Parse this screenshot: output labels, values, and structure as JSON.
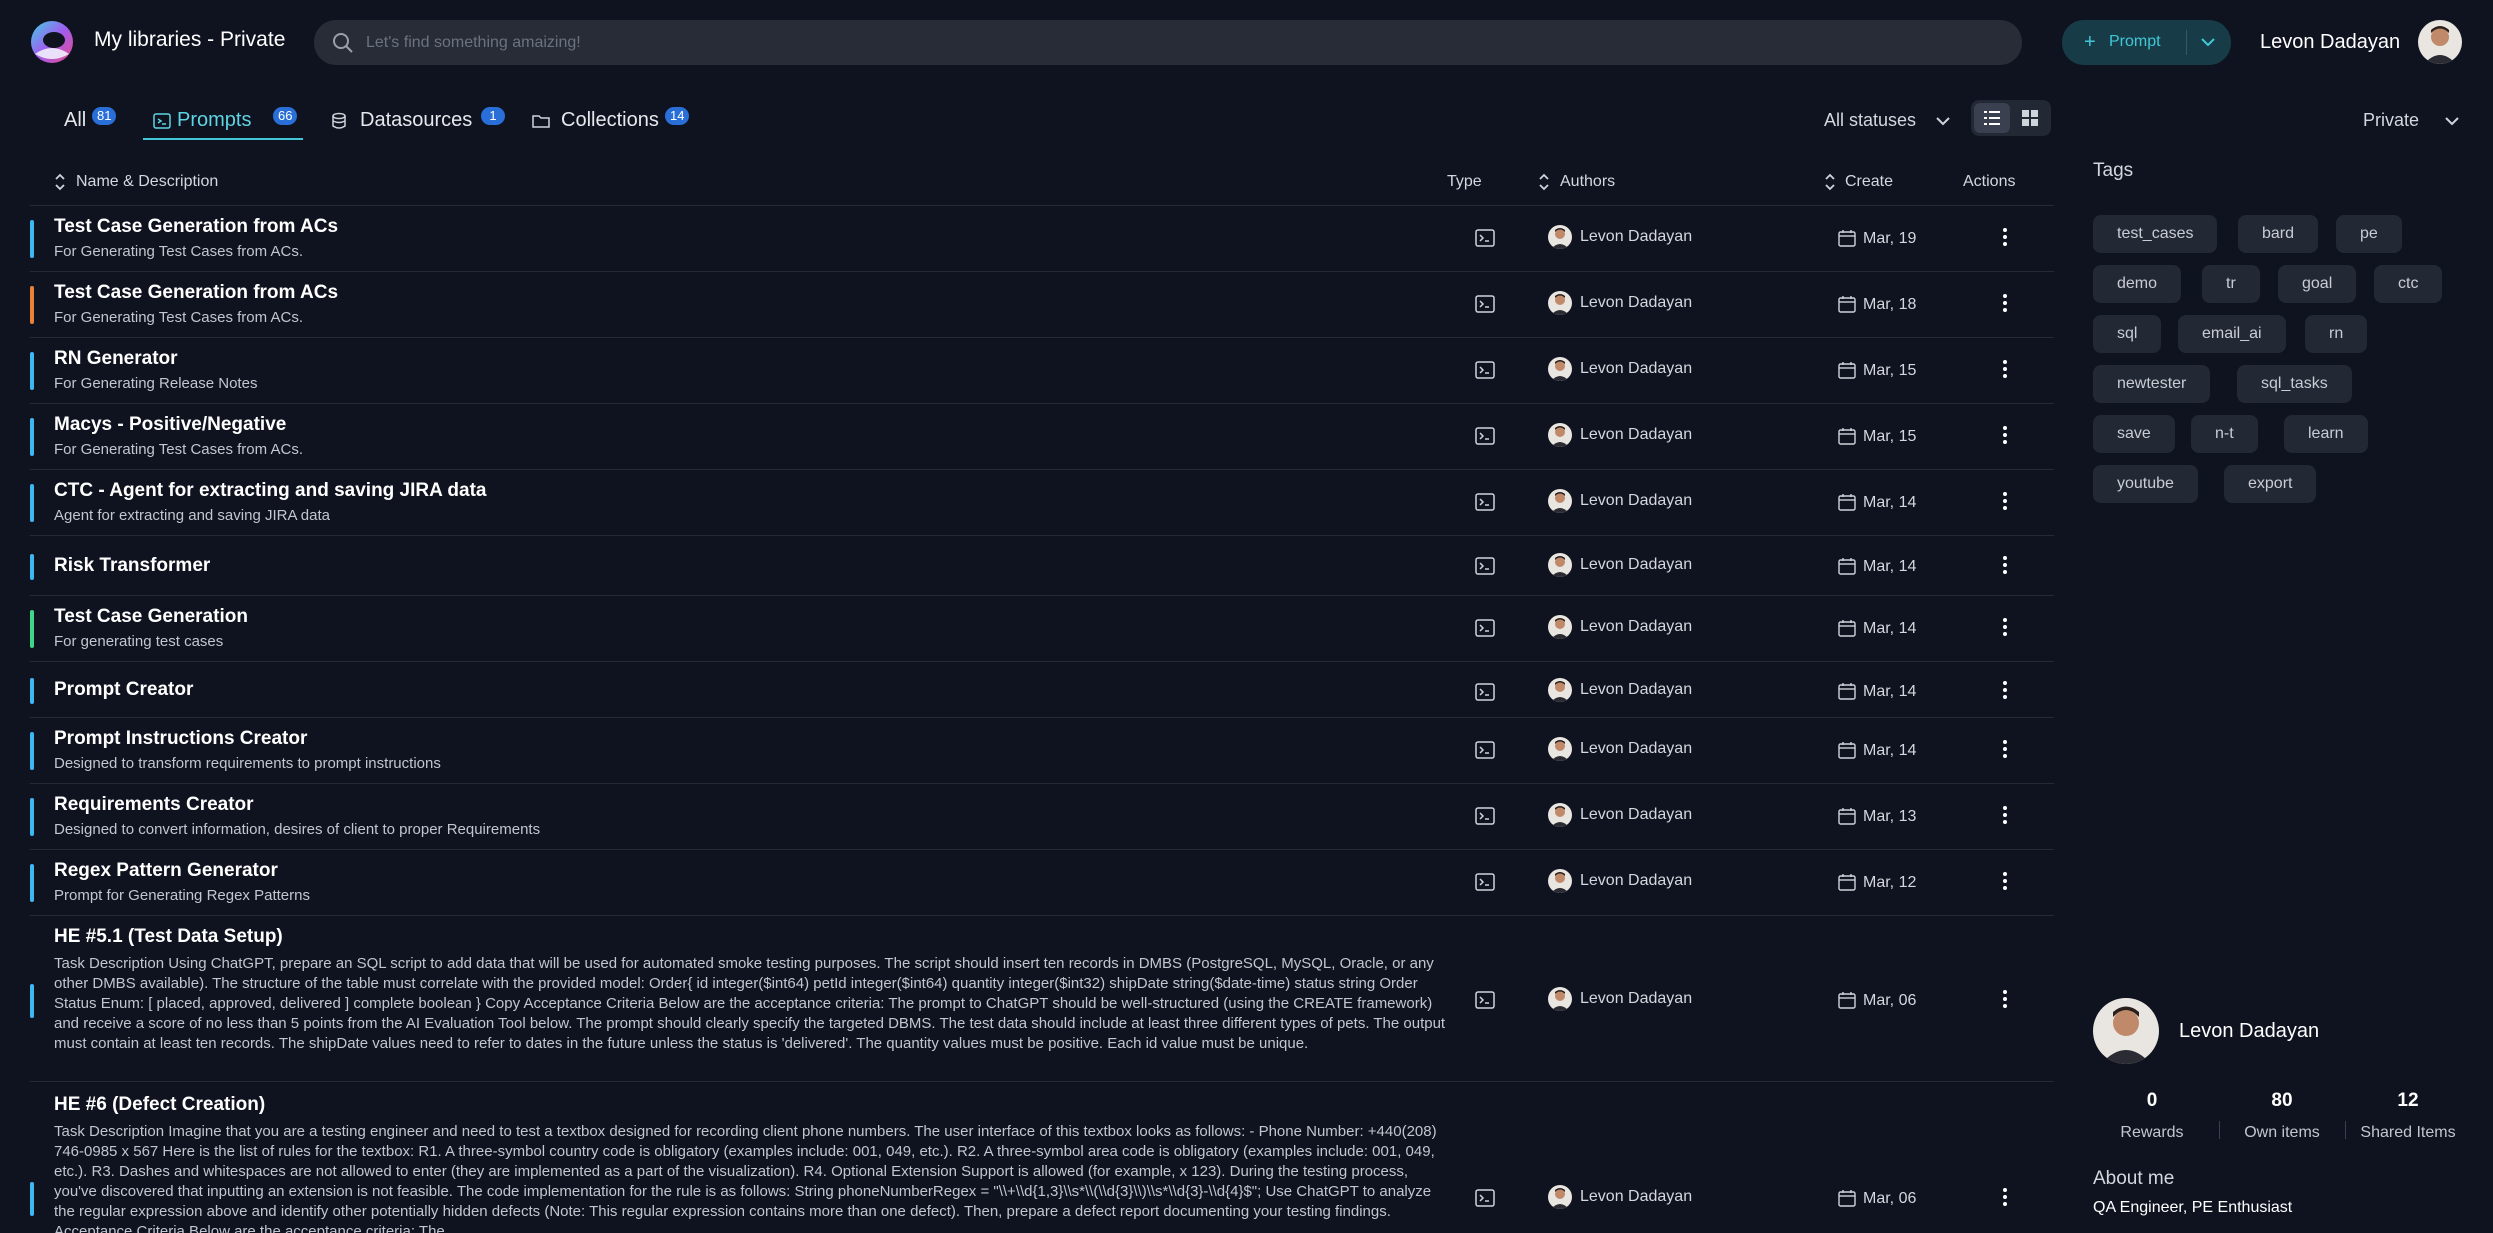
{
  "header": {
    "title": "My libraries - Private",
    "search_placeholder": "Let's find something amaizing!",
    "prompt_button": "Prompt",
    "user_name": "Levon Dadayan"
  },
  "tabs": [
    {
      "label": "All",
      "count": "81"
    },
    {
      "label": "Prompts",
      "count": "66"
    },
    {
      "label": "Datasources",
      "count": "1"
    },
    {
      "label": "Collections",
      "count": "14"
    }
  ],
  "status_filter": "All statuses",
  "visibility_filter": "Private",
  "columns": {
    "name": "Name & Description",
    "type": "Type",
    "authors": "Authors",
    "create": "Create",
    "actions": "Actions"
  },
  "rows": [
    {
      "name": "Test Case Generation from ACs",
      "desc": "For Generating Test Cases from ACs.",
      "author": "Levon Dadayan",
      "date": "Mar, 19",
      "color": "#3fb7f0"
    },
    {
      "name": "Test Case Generation from ACs",
      "desc": "For Generating Test Cases from ACs.",
      "author": "Levon Dadayan",
      "date": "Mar, 18",
      "color": "#e8823a"
    },
    {
      "name": "RN Generator",
      "desc": "For Generating Release Notes",
      "author": "Levon Dadayan",
      "date": "Mar, 15",
      "color": "#3fb7f0"
    },
    {
      "name": "Macys - Positive/Negative",
      "desc": "For Generating Test Cases from ACs.",
      "author": "Levon Dadayan",
      "date": "Mar, 15",
      "color": "#3fb7f0"
    },
    {
      "name": "CTC - Agent for extracting and saving JIRA data",
      "desc": "Agent for extracting and saving JIRA data",
      "author": "Levon Dadayan",
      "date": "Mar, 14",
      "color": "#3fb7f0"
    },
    {
      "name": "Risk Transformer",
      "desc": "",
      "author": "Levon Dadayan",
      "date": "Mar, 14",
      "color": "#3fb7f0"
    },
    {
      "name": "Test Case Generation",
      "desc": "For generating test cases",
      "author": "Levon Dadayan",
      "date": "Mar, 14",
      "color": "#3ed68a"
    },
    {
      "name": "Prompt Creator",
      "desc": "",
      "author": "Levon Dadayan",
      "date": "Mar, 14",
      "color": "#3fb7f0"
    },
    {
      "name": "Prompt Instructions Creator",
      "desc": "Designed to transform requirements to prompt instructions",
      "author": "Levon Dadayan",
      "date": "Mar, 14",
      "color": "#3fb7f0"
    },
    {
      "name": "Requirements Creator",
      "desc": "Designed to convert information, desires of client to proper Requirements",
      "author": "Levon Dadayan",
      "date": "Mar, 13",
      "color": "#3fb7f0"
    },
    {
      "name": "Regex Pattern Generator",
      "desc": "Prompt for Generating Regex Patterns",
      "author": "Levon Dadayan",
      "date": "Mar, 12",
      "color": "#3fb7f0"
    },
    {
      "name": "HE #5.1 (Test Data Setup)",
      "desc": "Task Description Using ChatGPT, prepare an SQL script to add data that will be used for automated smoke testing purposes. The script should insert ten records in DMBS (PostgreSQL, MySQL, Oracle, or any other DMBS available). The structure of the table must correlate with the provided model: Order{ id integer($int64) petId integer($int64) quantity integer($int32) shipDate string($date-time) status string Order Status Enum: [ placed, approved, delivered ] complete boolean } Copy Acceptance Criteria Below are the acceptance criteria: The prompt to ChatGPT should be well-structured (using the CREATE framework) and receive a score of no less than 5 points from the AI Evaluation Tool below. The prompt should clearly specify the targeted DBMS. The test data should include at least three different types of pets. The output must contain at least ten records. The shipDate values need to refer to dates in the future unless the status is 'delivered'. The quantity values must be positive. Each id value must be unique.",
      "author": "Levon Dadayan",
      "date": "Mar, 06",
      "color": "#3fb7f0"
    },
    {
      "name": "HE #6 (Defect Creation)",
      "desc": "Task Description Imagine that you are a testing engineer and need to test a textbox designed for recording client phone numbers. The user interface of this textbox looks as follows: - Phone Number: +440(208) 746-0985 x 567 Here is the list of rules for the textbox: R1. A three-symbol country code is obligatory (examples include: 001, 049, etc.). R2. A three-symbol area code is obligatory (examples include: 001, 049, etc.). R3. Dashes and whitespaces are not allowed to enter (they are implemented as a part of the visualization). R4. Optional Extension Support is allowed (for example, x 123). During the testing process, you've discovered that inputting an extension is not feasible. The code implementation for the rule is as follows: String phoneNumberRegex = \"\\\\+\\\\d{1,3}\\\\s*\\\\(\\\\d{3}\\\\)\\\\s*\\\\d{3}-\\\\d{4}$\"; Use ChatGPT to analyze the regular expression above and identify other potentially hidden defects (Note: This regular expression contains more than one defect). Then, prepare a defect report documenting your testing findings. Acceptance Criteria Below are the acceptance criteria: The",
      "author": "Levon Dadayan",
      "date": "Mar, 06",
      "color": "#3fb7f0"
    }
  ],
  "tags_title": "Tags",
  "tags": [
    "test_cases",
    "bard",
    "pe",
    "demo",
    "tr",
    "goal",
    "ctc",
    "sql",
    "email_ai",
    "rn",
    "newtester",
    "sql_tasks",
    "save",
    "n-t",
    "learn",
    "youtube",
    "export"
  ],
  "profile": {
    "name": "Levon Dadayan",
    "stats": [
      {
        "value": "0",
        "label": "Rewards"
      },
      {
        "value": "80",
        "label": "Own items"
      },
      {
        "value": "12",
        "label": "Shared Items"
      }
    ],
    "about_title": "About me",
    "about_text": "QA Engineer, PE Enthusiast"
  },
  "colors": {
    "accent": "#41c7d6",
    "badge": "#2a6fd8",
    "background": "#0e131f"
  }
}
